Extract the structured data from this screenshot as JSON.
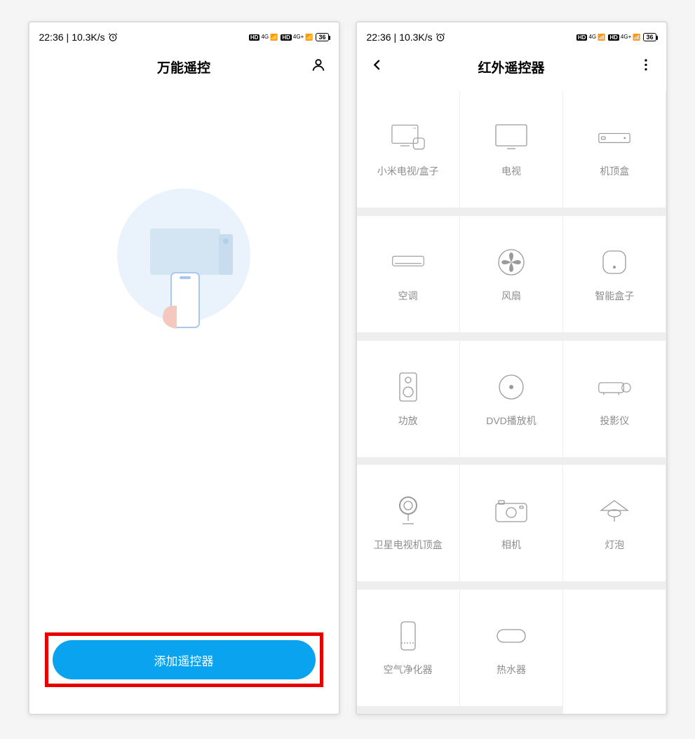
{
  "status": {
    "time": "22:36",
    "speed": "10.3K/s",
    "battery": "36"
  },
  "screen1": {
    "title": "万能遥控",
    "add_button": "添加遥控器"
  },
  "screen2": {
    "title": "红外遥控器",
    "devices": [
      {
        "id": "mi-tv-box",
        "label": "小米电视/盒子"
      },
      {
        "id": "tv",
        "label": "电视"
      },
      {
        "id": "stb",
        "label": "机顶盒"
      },
      {
        "id": "ac",
        "label": "空调"
      },
      {
        "id": "fan",
        "label": "风扇"
      },
      {
        "id": "smart-box",
        "label": "智能盒子"
      },
      {
        "id": "amplifier",
        "label": "功放"
      },
      {
        "id": "dvd",
        "label": "DVD播放机"
      },
      {
        "id": "projector",
        "label": "投影仪"
      },
      {
        "id": "satellite",
        "label": "卫星电视机顶盒"
      },
      {
        "id": "camera",
        "label": "相机"
      },
      {
        "id": "bulb",
        "label": "灯泡"
      },
      {
        "id": "air-purifier",
        "label": "空气净化器"
      },
      {
        "id": "water-heater",
        "label": "热水器"
      }
    ]
  }
}
